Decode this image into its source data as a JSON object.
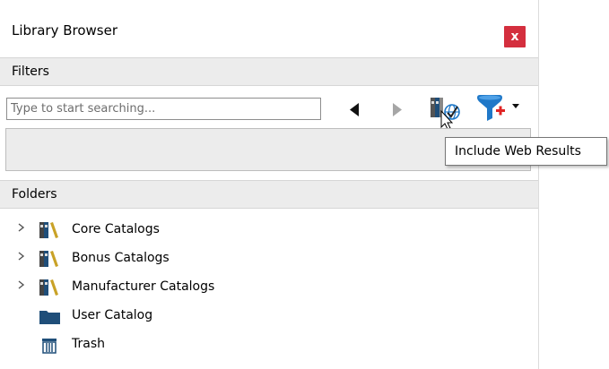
{
  "window": {
    "title": "Library Browser",
    "close_label": "x"
  },
  "filters": {
    "header": "Filters",
    "search_placeholder": "Type to start searching...",
    "search_value": "",
    "back_icon": "triangle-left-icon",
    "forward_icon": "triangle-right-icon",
    "web_results_icon": "library-web-results-icon",
    "filter_icon": "filter-add-icon",
    "accent_filter": "#1f78c8",
    "accent_add": "#e02424"
  },
  "tooltip": {
    "text": "Include Web Results"
  },
  "folders": {
    "header": "Folders",
    "items": [
      {
        "label": "Core Catalogs",
        "icon": "catalog-books-icon",
        "expandable": true
      },
      {
        "label": "Bonus Catalogs",
        "icon": "catalog-books-icon",
        "expandable": true
      },
      {
        "label": "Manufacturer Catalogs",
        "icon": "catalog-books-icon",
        "expandable": true
      },
      {
        "label": "User Catalog",
        "icon": "folder-icon",
        "expandable": false
      },
      {
        "label": "Trash",
        "icon": "trash-icon",
        "expandable": false
      }
    ]
  },
  "colors": {
    "close_button": "#d42f3e",
    "section_header": "#ececec",
    "folder_blue": "#1f4e79"
  }
}
